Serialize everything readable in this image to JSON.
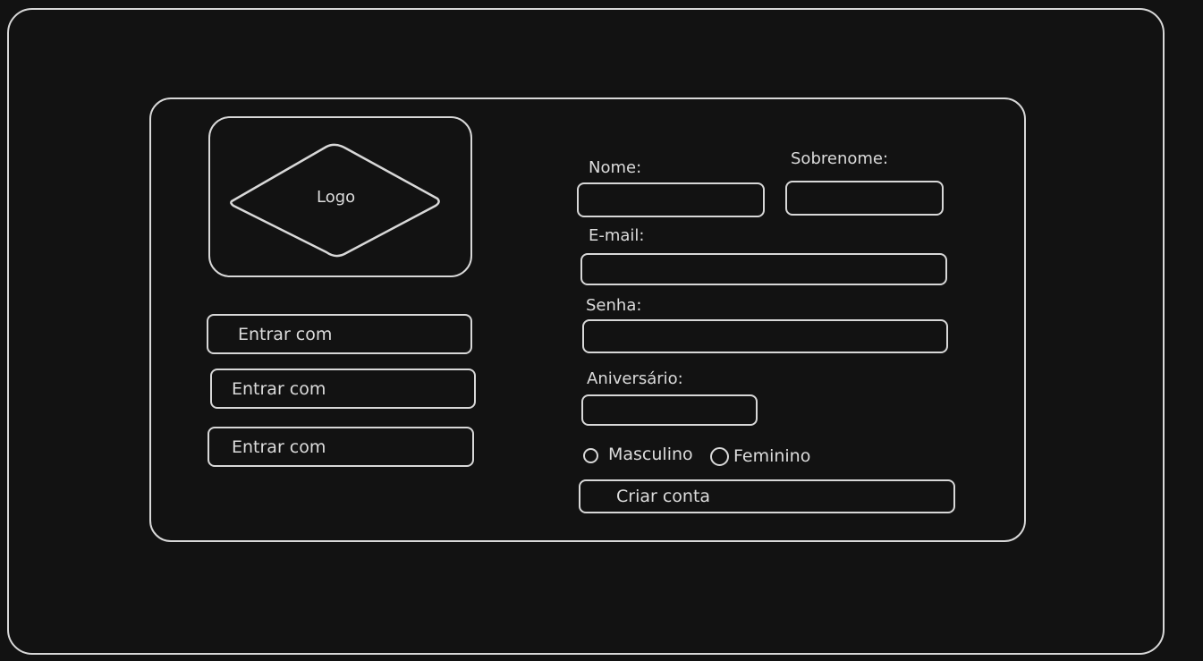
{
  "logo": {
    "label": "Logo"
  },
  "social_buttons": [
    {
      "label": "Entrar com"
    },
    {
      "label": "Entrar com"
    },
    {
      "label": "Entrar com"
    }
  ],
  "form": {
    "first_name_label": "Nome:",
    "last_name_label": "Sobrenome:",
    "email_label": "E-mail:",
    "password_label": "Senha:",
    "birthday_label": "Aniversário:",
    "gender_options": [
      "Masculino",
      "Feminino"
    ],
    "submit_label": "Criar conta"
  }
}
